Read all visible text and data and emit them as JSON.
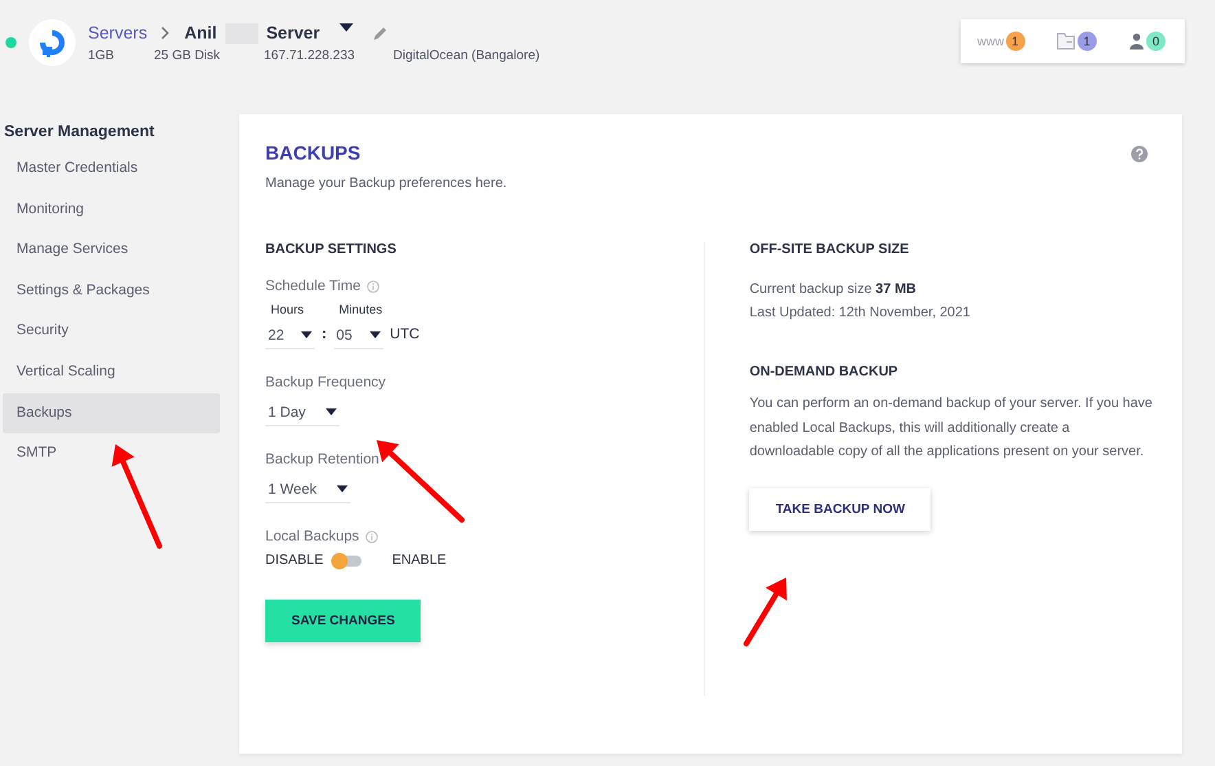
{
  "header": {
    "online": true,
    "breadcrumb": "Servers",
    "server_name_first": "Anil",
    "server_name_last": "Server",
    "specs": [
      "1GB",
      "25 GB Disk",
      "167.71.228.233",
      "DigitalOcean (Bangalore)"
    ],
    "counters": [
      {
        "kind": "www",
        "label": "www",
        "count": "1",
        "color": "#f6a24a"
      },
      {
        "kind": "folder",
        "count": "1",
        "color": "#9a9ce6"
      },
      {
        "kind": "user",
        "count": "0",
        "color": "#7ee8c8"
      }
    ]
  },
  "sidebar": {
    "title": "Server Management",
    "items": [
      {
        "label": "Master Credentials",
        "selected": false
      },
      {
        "label": "Monitoring",
        "selected": false
      },
      {
        "label": "Manage Services",
        "selected": false
      },
      {
        "label": "Settings & Packages",
        "selected": false
      },
      {
        "label": "Security",
        "selected": false
      },
      {
        "label": "Vertical Scaling",
        "selected": false
      },
      {
        "label": "Backups",
        "selected": true
      },
      {
        "label": "SMTP",
        "selected": false
      }
    ]
  },
  "panel": {
    "title": "BACKUPS",
    "subtitle": "Manage your Backup preferences here.",
    "settings": {
      "title": "BACKUP SETTINGS",
      "schedule_label": "Schedule Time",
      "hours_label": "Hours",
      "hours": "22",
      "separator": ":",
      "minutes_label": "Minutes",
      "minutes": "05",
      "timezone": "UTC",
      "frequency_label": "Backup Frequency",
      "frequency": "1 Day",
      "retention_label": "Backup Retention",
      "retention": "1 Week",
      "local_label": "Local Backups",
      "off_label": "DISABLE",
      "on_label": "ENABLE",
      "local_enabled": false,
      "save": "SAVE CHANGES"
    },
    "offsite": {
      "title": "OFF-SITE BACKUP SIZE",
      "size_text": "Current backup size **37 MB**",
      "updated": "Last Updated: 12th November, 2021"
    },
    "on_demand": {
      "title": "ON-DEMAND BACKUP",
      "text": "You can perform an on-demand backup of your server. If you have enabled Local Backups, this will additionally create a downloadable copy of all the applications present on your server.",
      "button": "TAKE BACKUP NOW"
    }
  }
}
